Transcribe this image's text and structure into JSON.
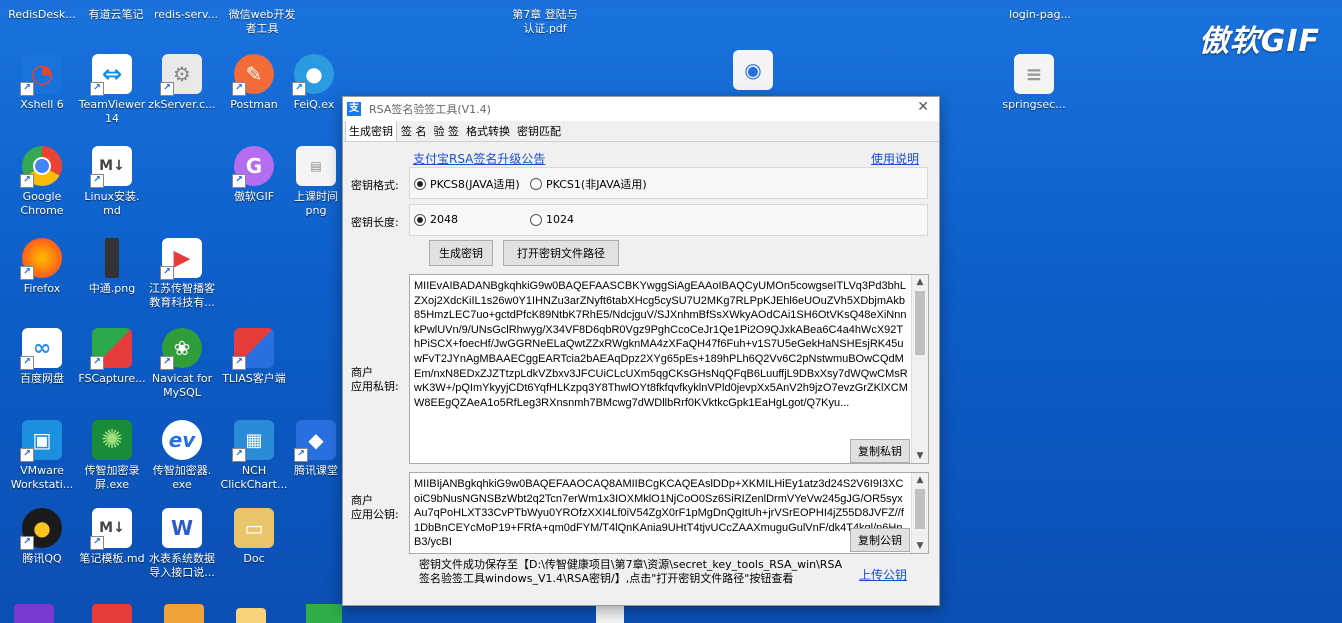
{
  "watermark": "傲软GIF",
  "top_labels": [
    "RedisDesk...",
    "有道云笔记",
    "redis-serv...",
    "微信web开发\n者工具",
    "第7章 登陆与\n认证.pdf",
    "login-pag..."
  ],
  "desktop_icons": [
    {
      "label": "Xshell 6",
      "icon": "xshell-icon"
    },
    {
      "label": "TeamViewer\n14",
      "icon": "teamviewer-icon"
    },
    {
      "label": "zkServer.c...",
      "icon": "gear-file-icon"
    },
    {
      "label": "Postman",
      "icon": "postman-icon"
    },
    {
      "label": "FeiQ.ex",
      "icon": "feiq-icon"
    },
    {
      "label": "Google\nChrome",
      "icon": "chrome-icon"
    },
    {
      "label": "Linux安装.\nmd",
      "icon": "markdown-icon"
    },
    {
      "label": "傲软GIF",
      "icon": "gif-app-icon"
    },
    {
      "label": "上课时间\npng",
      "icon": "image-file-icon"
    },
    {
      "label": "Firefox",
      "icon": "firefox-icon"
    },
    {
      "label": "中通.png",
      "icon": "image-file-icon"
    },
    {
      "label": "江苏传智播客\n教育科技有...",
      "icon": "video-icon"
    },
    {
      "label": "百度网盘",
      "icon": "baidu-netdisk-icon"
    },
    {
      "label": "FSCapture...",
      "icon": "fscapture-icon"
    },
    {
      "label": "Navicat for\nMySQL",
      "icon": "navicat-icon"
    },
    {
      "label": "TLIAS客户端",
      "icon": "tlias-icon"
    },
    {
      "label": "VMware\nWorkstati...",
      "icon": "vmware-icon"
    },
    {
      "label": "传智加密录\n屏.exe",
      "icon": "recorder-icon"
    },
    {
      "label": "传智加密器.\nexe",
      "icon": "encryptor-icon"
    },
    {
      "label": "NCH\nClickChart...",
      "icon": "clickchart-icon"
    },
    {
      "label": "腾讯课堂",
      "icon": "tencent-class-icon"
    },
    {
      "label": "腾讯QQ",
      "icon": "qq-icon"
    },
    {
      "label": "笔记模板.md",
      "icon": "markdown-icon"
    },
    {
      "label": "水表系统数据\n导入接口说...",
      "icon": "word-doc-icon"
    },
    {
      "label": "Doc",
      "icon": "folder-icon"
    },
    {
      "label": "springsec...",
      "icon": "text-file-icon"
    }
  ],
  "dialog": {
    "title": "RSA签名验签工具(V1.4)",
    "tabs": [
      "生成密钥",
      "签 名",
      "验 签",
      "格式转换",
      "密钥匹配"
    ],
    "announce_link": "支付宝RSA签名升级公告",
    "help_link": "使用说明",
    "format_label": "密钥格式:",
    "format_opt1": "PKCS8(JAVA适用)",
    "format_opt2": "PKCS1(非JAVA适用)",
    "length_label": "密钥长度:",
    "length_opt1": "2048",
    "length_opt2": "1024",
    "generate_btn": "生成密钥",
    "open_path_btn": "打开密钥文件路径",
    "private_label_1": "商户",
    "private_label_2": "应用私钥:",
    "private_key": "MIIEvAIBADANBgkqhkiG9w0BAQEFAASCBKYwggSiAgEAAoIBAQCyUMOn5cowgseITLVq3Pd3bhLZXoj2XdcKiIL1s26w0Y1IHNZu3arZNyft6tabXHcg5cySU7U2MKg7RLPpKJEhl6eUOuZVh5XDbjmAkb85HmzLEC7uo+gctdPfcK89NtbK7RhE5/NdcjguV/SJXnhmBfSsXWkyAOdCAi1SH6OtVKsQ48eXiNnnkPwlUVn/9/UNsGclRhwyg/X34VF8D6qbR0Vgz9PghCcoCeJr1Qe1Pi2O9QJxkABea6C4a4hWcX92ThPiSCX+foecHf/JwGGRNeELaQwtZZxRWgknMA4zXFaQH47f6Fuh+v1S7U5eGekHaNSHEsjRK45uwFvT2JYnAgMBAAECggEARTcia2bAEAqDpz2XYg65pEs+189hPLh6Q2Vv6C2pNstwmuBOwCQdMEm/nxN8EDxZJZTtzpLdkVZbxv3JFCUiCLcUXm5qgCKsGHsNqQFqB6LuuffjL9DBxXsy7dWQwCMsRwK3W+/pQImYkyyjCDt6YqfHLKzpq3Y8ThwlOYt8fkfqvfkyklnVPld0jevpXx5AnV2h9jzO7evzGrZKlXCMW8EEgQZAeA1o5RfLeg3RXnsnmh7BMcwg7dWDllbRrf0KVktkcGpk1EaHgLgot/Q7Kyu...",
    "copy_private_btn": "复制私钥",
    "public_label_1": "商户",
    "public_label_2": "应用公钥:",
    "public_key": "MIIBIjANBgkqhkiG9w0BAQEFAAOCAQ8AMIIBCgKCAQEAslDDp+XKMILHiEy1atz3d24S2V6I9I3XCoiC9bNusNGNSBzWbt2q2Tcn7erWm1x3IOXMklO1NjCoO0Sz6SiRIZenlDrmVYeVw245gJG/OR5syxAu7qPoHLXT33CvPTbWyu0YROfzXXI4Lf0iV54ZgX0rF1pMgDnQgItUh+jrVSrEOPHI4jZ55D8JVFZ//f1DbBnCEYcMoP19+FRfA+qm0dFYM/T4lQnKAnia9UHtT4tjvUCcZAAXmuguGulVnF/dk4T4kgl/n6HnB3/ycBI",
    "copy_public_btn": "复制公钥",
    "status_text": "密钥文件成功保存至【D:\\传智健康项目\\第7章\\资源\\secret_key_tools_RSA_win\\RSA签名验签工具windows_V1.4\\RSA密钥/】,点击\"打开密钥文件路径\"按钮查看",
    "upload_public_link": "上传公钥"
  }
}
